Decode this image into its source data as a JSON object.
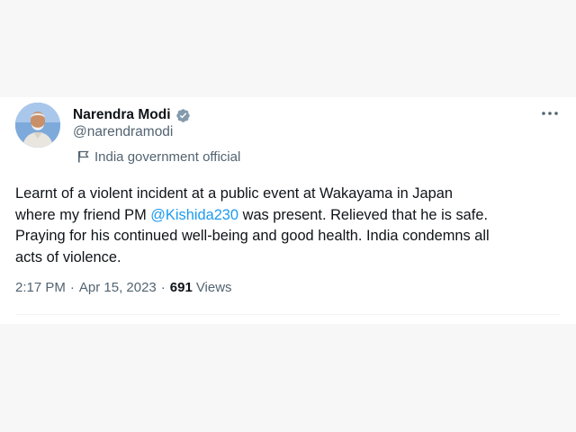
{
  "author": {
    "name": "Narendra Modi",
    "handle": "@narendramodi",
    "affiliation": "India government official",
    "verified_icon": "verified-badge",
    "affiliation_icon": "flag-icon"
  },
  "tweet": {
    "lines": [
      {
        "text": "Learnt of a violent incident at a public event at Wakayama in Japan"
      },
      {
        "pre": "where my friend PM ",
        "mention": "@Kishida230",
        "post": " was present. Relieved that he is safe."
      },
      {
        "text": "Praying for his continued well-being and good health. India condemns all"
      },
      {
        "text": "acts of violence."
      }
    ]
  },
  "meta": {
    "time": "2:17 PM",
    "date": "Apr 15, 2023",
    "separator": "·",
    "views_count": "691",
    "views_label": "Views"
  },
  "colors": {
    "accent": "#1d9bf0",
    "verified": "#829aab",
    "secondary_text": "#536471"
  }
}
